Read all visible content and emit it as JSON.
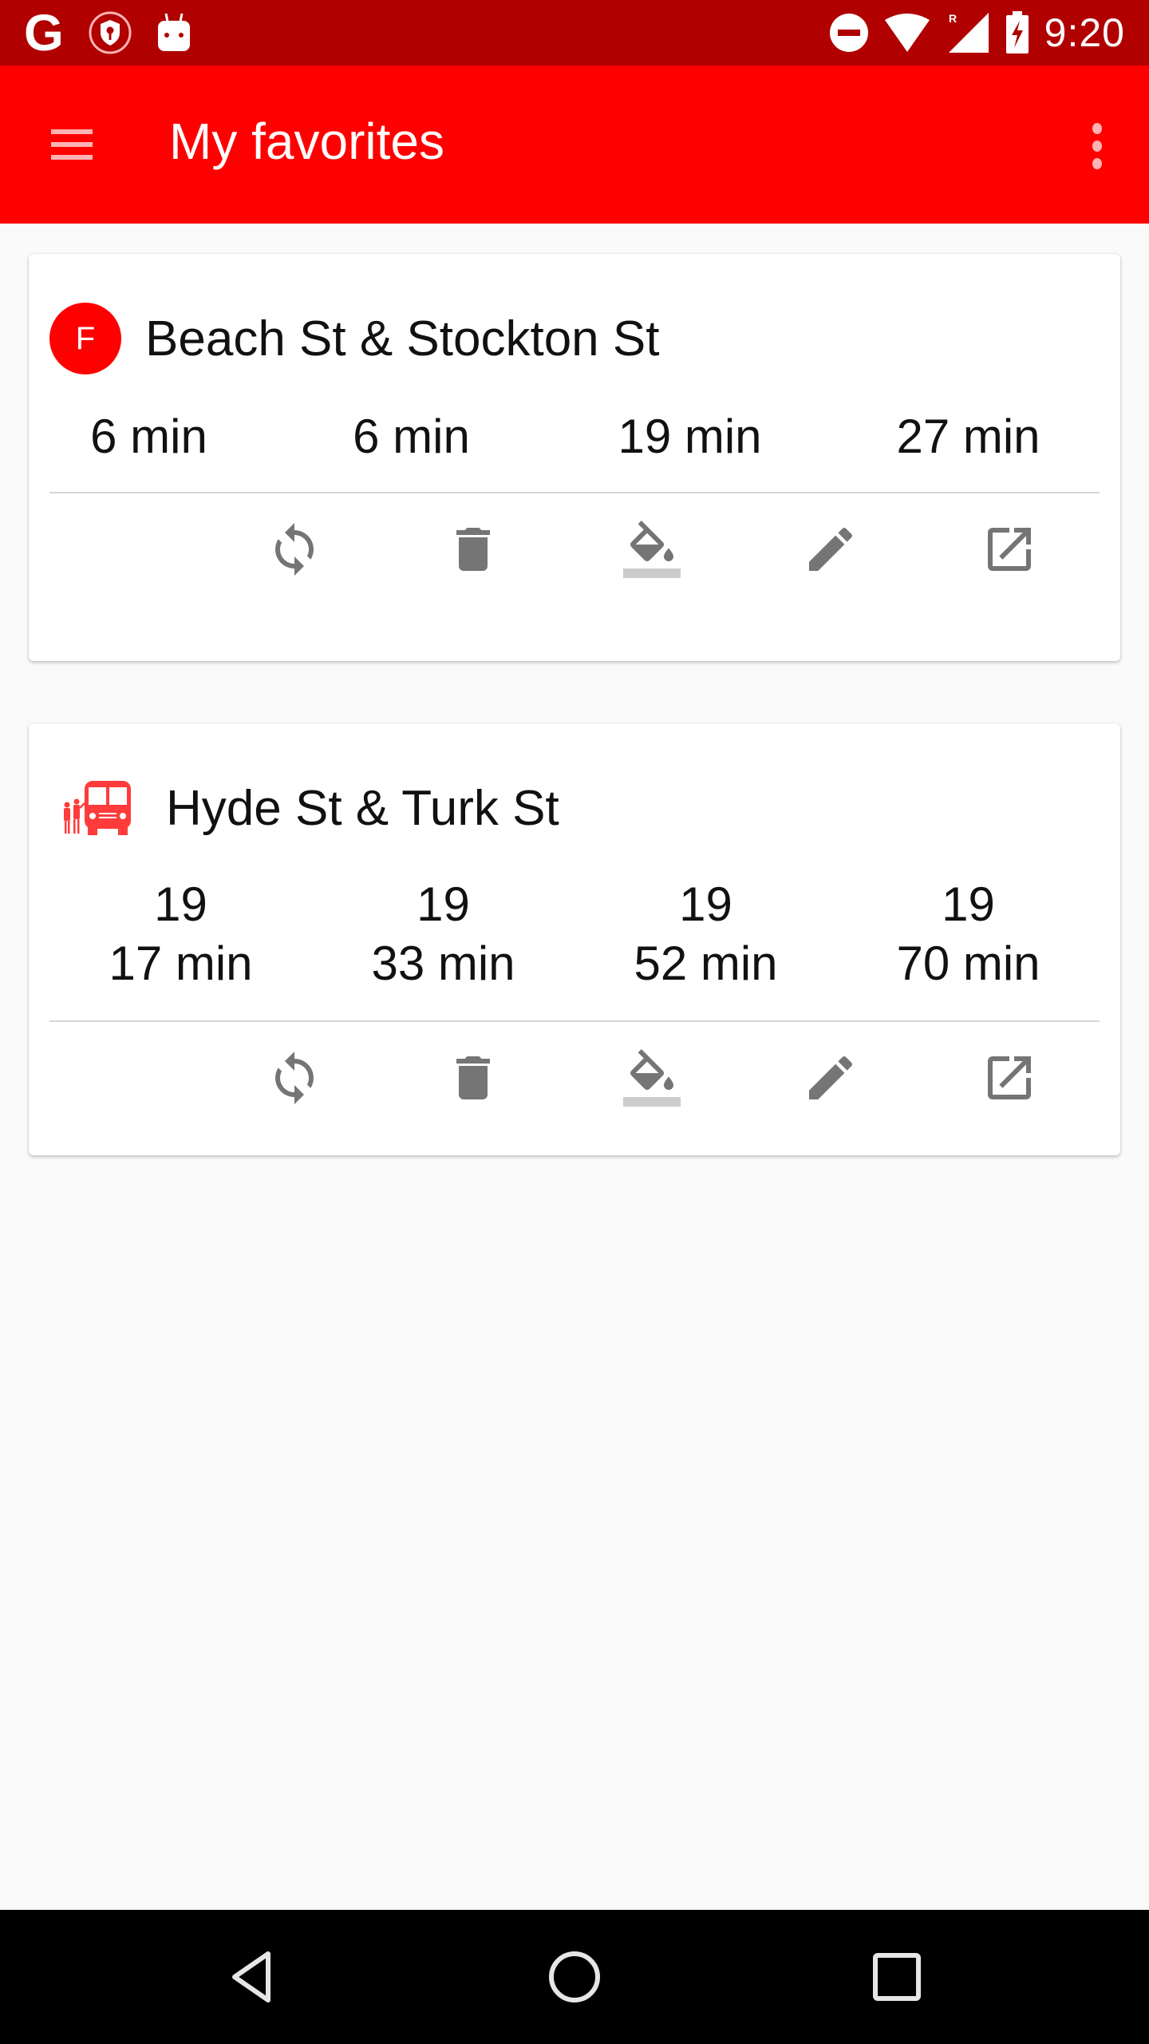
{
  "status_bar": {
    "time": "9:20",
    "left_icons": [
      "google-icon",
      "vpn-key-shield-icon",
      "android-notification-icon"
    ],
    "right_icons": [
      "do-not-disturb-icon",
      "wifi-icon",
      "roaming-signal-icon",
      "battery-charging-icon"
    ],
    "roaming_label": "R",
    "google_glyph": "G"
  },
  "app_bar": {
    "title": "My favorites",
    "menu_icon": "hamburger-menu-icon",
    "overflow_icon": "more-vert-icon",
    "color": "#ff0000"
  },
  "favorites": [
    {
      "type": "route-badge",
      "badge": "F",
      "badge_color": "#ff0000",
      "stop_name": "Beach St & Stockton St",
      "arrivals": [
        {
          "route": "",
          "eta": "6 min"
        },
        {
          "route": "",
          "eta": "6 min"
        },
        {
          "route": "",
          "eta": "19 min"
        },
        {
          "route": "",
          "eta": "27 min"
        }
      ],
      "actions": [
        "refresh",
        "delete",
        "change-color",
        "edit",
        "open-external"
      ]
    },
    {
      "type": "bus-stop",
      "icon": "bus-stop-icon",
      "icon_color": "#ff3b3b",
      "stop_name": "Hyde St & Turk St",
      "arrivals": [
        {
          "route": "19",
          "eta": "17 min"
        },
        {
          "route": "19",
          "eta": "33 min"
        },
        {
          "route": "19",
          "eta": "52 min"
        },
        {
          "route": "19",
          "eta": "70 min"
        }
      ],
      "actions": [
        "refresh",
        "delete",
        "change-color",
        "edit",
        "open-external"
      ]
    }
  ],
  "nav_bar": {
    "buttons": [
      "back",
      "home",
      "recents"
    ]
  }
}
